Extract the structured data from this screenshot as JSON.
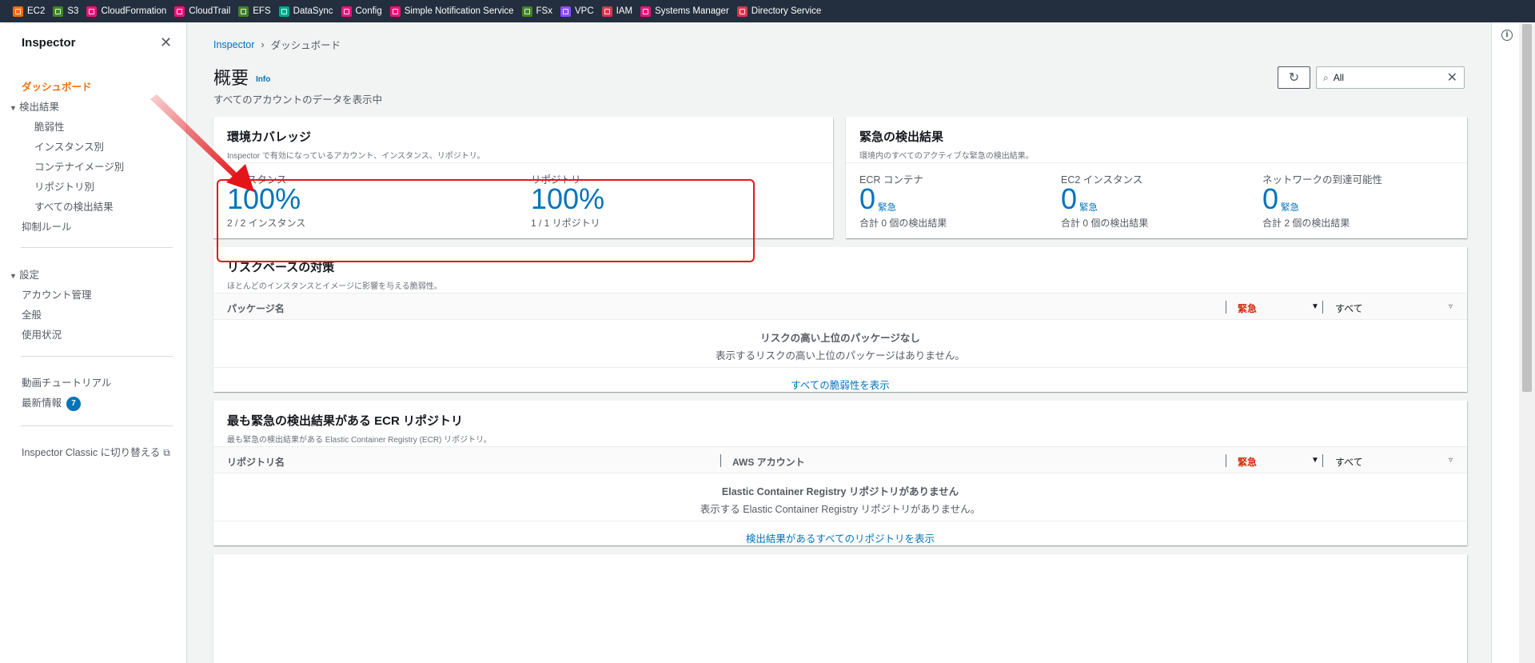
{
  "favorites": [
    {
      "label": "EC2",
      "color": "#ed7100"
    },
    {
      "label": "S3",
      "color": "#3f8624"
    },
    {
      "label": "CloudFormation",
      "color": "#e7157b"
    },
    {
      "label": "CloudTrail",
      "color": "#e7157b"
    },
    {
      "label": "EFS",
      "color": "#3f8624"
    },
    {
      "label": "DataSync",
      "color": "#01a88d"
    },
    {
      "label": "Config",
      "color": "#e7157b"
    },
    {
      "label": "Simple Notification Service",
      "color": "#e7157b"
    },
    {
      "label": "FSx",
      "color": "#3f8624"
    },
    {
      "label": "VPC",
      "color": "#8c4fff"
    },
    {
      "label": "IAM",
      "color": "#dd344c"
    },
    {
      "label": "Systems Manager",
      "color": "#e7157b"
    },
    {
      "label": "Directory Service",
      "color": "#dd344c"
    }
  ],
  "sidebar": {
    "title": "Inspector",
    "dashboard": "ダッシュボード",
    "findings": "検出結果",
    "findings_children": [
      "脆弱性",
      "インスタンス別",
      "コンテナイメージ別",
      "リポジトリ別",
      "すべての検出結果"
    ],
    "suppression": "抑制ルール",
    "settings": "設定",
    "settings_children": [
      "アカウント管理",
      "全般",
      "使用状況"
    ],
    "video": "動画チュートリアル",
    "whats_new": "最新情報",
    "whats_new_badge": "7",
    "classic": "Inspector Classic に切り替える"
  },
  "breadcrumb": {
    "root": "Inspector",
    "current": "ダッシュボード"
  },
  "header": {
    "title": "概要",
    "info": "Info",
    "subtitle": "すべてのアカウントのデータを表示中",
    "search_value": "All"
  },
  "coverage": {
    "title": "環境カバレッジ",
    "subtitle": "Inspector で有効になっているアカウント、インスタンス、リポジトリ。",
    "instances": {
      "label": "インスタンス",
      "value": "100%",
      "foot": "2 / 2 インスタンス"
    },
    "repositories": {
      "label": "リポジトリ",
      "value": "100%",
      "foot": "1 / 1 リポジトリ"
    }
  },
  "critical": {
    "title": "緊急の検出結果",
    "subtitle": "環境内のすべてのアクティブな緊急の検出結果。",
    "items": [
      {
        "label": "ECR コンテナ",
        "value": "0",
        "unit": "緊急",
        "foot": "合計 0 個の検出結果"
      },
      {
        "label": "EC2 インスタンス",
        "value": "0",
        "unit": "緊急",
        "foot": "合計 0 個の検出結果"
      },
      {
        "label": "ネットワークの到達可能性",
        "value": "0",
        "unit": "緊急",
        "foot": "合計 2 個の検出結果"
      }
    ]
  },
  "risk": {
    "title": "リスクベースの対策",
    "subtitle": "ほとんどのインスタンスとイメージに影響を与える脆弱性。",
    "col_package": "パッケージ名",
    "col_critical": "緊急",
    "col_all": "すべて",
    "empty_title": "リスクの高い上位のパッケージなし",
    "empty_sub": "表示するリスクの高い上位のパッケージはありません。",
    "view_all": "すべての脆弱性を表示"
  },
  "ecr": {
    "title": "最も緊急の検出結果がある ECR リポジトリ",
    "subtitle": "最も緊急の検出結果がある Elastic Container Registry (ECR) リポジトリ。",
    "col_repo": "リポジトリ名",
    "col_account": "AWS アカウント",
    "col_critical": "緊急",
    "col_all": "すべて",
    "empty_title": "Elastic Container Registry リポジトリがありません",
    "empty_sub": "表示する Elastic Container Registry リポジトリがありません。",
    "view_all": "検出結果があるすべてのリポジトリを表示"
  },
  "colors": {
    "accent": "#ec7211",
    "link": "#0073bb",
    "critical": "#d13212",
    "annotation": "#e3151a",
    "topbar": "#232f3e"
  }
}
